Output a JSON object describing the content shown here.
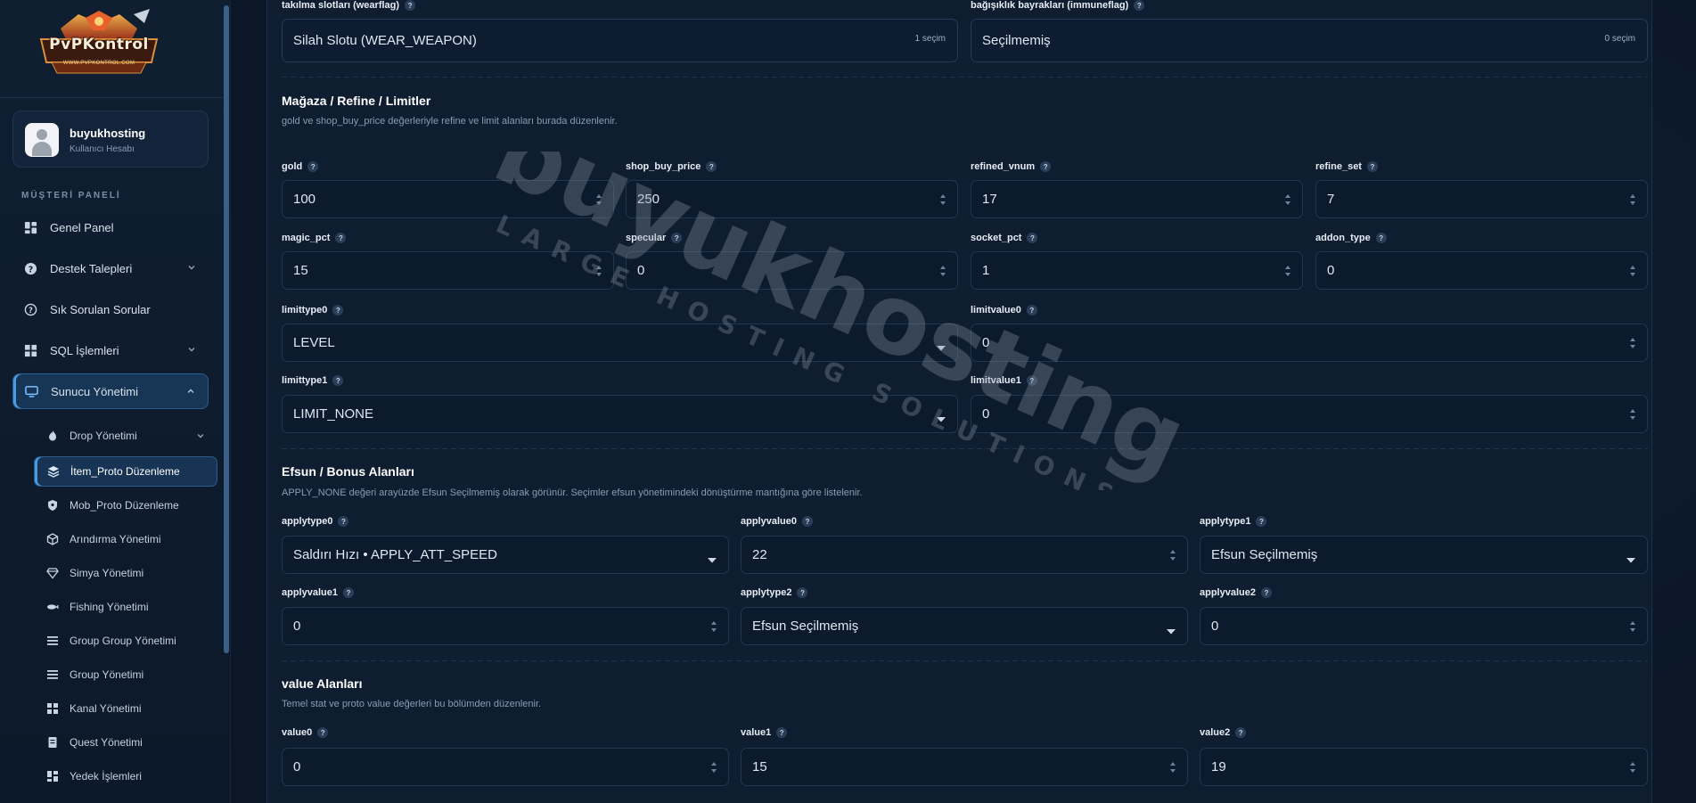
{
  "brand": {
    "logo_text": "PvPKontrol",
    "logo_sub": "WWW.PVPKONTROL.COM"
  },
  "user": {
    "name": "buyukhosting",
    "role": "Kullanıcı Hesabı"
  },
  "sidebar": {
    "section_header": "MÜŞTERİ PANELİ",
    "items": [
      {
        "label": "Genel Panel",
        "icon": "dashboard-icon"
      },
      {
        "label": "Destek Talepleri",
        "icon": "help-circle-icon"
      },
      {
        "label": "Sık Sorulan Sorular",
        "icon": "question-icon"
      },
      {
        "label": "SQL İşlemleri",
        "icon": "grid-icon"
      },
      {
        "label": "Sunucu Yönetimi",
        "icon": "monitor-icon"
      }
    ],
    "sub_items": [
      {
        "label": "Drop Yönetimi",
        "icon": "flame-icon"
      },
      {
        "label": "İtem_Proto Düzenleme",
        "icon": "layers-icon"
      },
      {
        "label": "Mob_Proto Düzenleme",
        "icon": "shield-icon"
      },
      {
        "label": "Arındırma Yönetimi",
        "icon": "cube-icon"
      },
      {
        "label": "Simya Yönetimi",
        "icon": "diamond-icon"
      },
      {
        "label": "Fishing Yönetimi",
        "icon": "fish-icon"
      },
      {
        "label": "Group Group Yönetimi",
        "icon": "list-icon"
      },
      {
        "label": "Group Yönetimi",
        "icon": "list-icon"
      },
      {
        "label": "Kanal Yönetimi",
        "icon": "grid-icon"
      },
      {
        "label": "Quest Yönetimi",
        "icon": "file-icon"
      },
      {
        "label": "Yedek İşlemleri",
        "icon": "grid-icon"
      }
    ]
  },
  "form": {
    "wearflag": {
      "label": "takılma slotları (wearflag)",
      "value": "Silah Slotu (WEAR_WEAPON)",
      "count": "1 seçim"
    },
    "immuneflag": {
      "label": "bağışıklık bayrakları (immuneflag)",
      "value": "Seçilmemiş",
      "count": "0 seçim"
    },
    "shop_section": {
      "title": "Mağaza / Refine / Limitler",
      "desc": "gold ve shop_buy_price değerleriyle refine ve limit alanları burada düzenlenir."
    },
    "gold": {
      "label": "gold",
      "value": "100"
    },
    "shop_buy_price": {
      "label": "shop_buy_price",
      "value": "250"
    },
    "refined_vnum": {
      "label": "refined_vnum",
      "value": "17"
    },
    "refine_set": {
      "label": "refine_set",
      "value": "7"
    },
    "magic_pct": {
      "label": "magic_pct",
      "value": "15"
    },
    "specular": {
      "label": "specular",
      "value": "0"
    },
    "socket_pct": {
      "label": "socket_pct",
      "value": "1"
    },
    "addon_type": {
      "label": "addon_type",
      "value": "0"
    },
    "limittype0": {
      "label": "limittype0",
      "value": "LEVEL"
    },
    "limitvalue0": {
      "label": "limitvalue0",
      "value": "0"
    },
    "limittype1": {
      "label": "limittype1",
      "value": "LIMIT_NONE"
    },
    "limitvalue1": {
      "label": "limitvalue1",
      "value": "0"
    },
    "bonus_section": {
      "title": "Efsun / Bonus Alanları",
      "desc": "APPLY_NONE değeri arayüzde Efsun Seçilmemiş olarak görünür. Seçimler efsun yönetimindeki dönüştürme mantığına göre listelenir."
    },
    "applytype0": {
      "label": "applytype0",
      "value": "Saldırı Hızı • APPLY_ATT_SPEED"
    },
    "applyvalue0": {
      "label": "applyvalue0",
      "value": "22"
    },
    "applytype1": {
      "label": "applytype1",
      "value": "Efsun Seçilmemiş"
    },
    "applyvalue1": {
      "label": "applyvalue1",
      "value": "0"
    },
    "applytype2": {
      "label": "applytype2",
      "value": "Efsun Seçilmemiş"
    },
    "applyvalue2": {
      "label": "applyvalue2",
      "value": "0"
    },
    "value_section": {
      "title": "value Alanları",
      "desc": "Temel stat ve proto value değerleri bu bölümden düzenlenir."
    },
    "value0": {
      "label": "value0",
      "value": "0"
    },
    "value1": {
      "label": "value1",
      "value": "15"
    },
    "value2": {
      "label": "value2",
      "value": "19"
    }
  },
  "watermark": {
    "main": "buyukhosting",
    "sub": "LARGE HOSTING SOLUTIONS"
  },
  "help_glyph": "?",
  "colors": {
    "accent": "#4a9be6",
    "background": "#0b1626",
    "panel": "#0f1d31"
  }
}
